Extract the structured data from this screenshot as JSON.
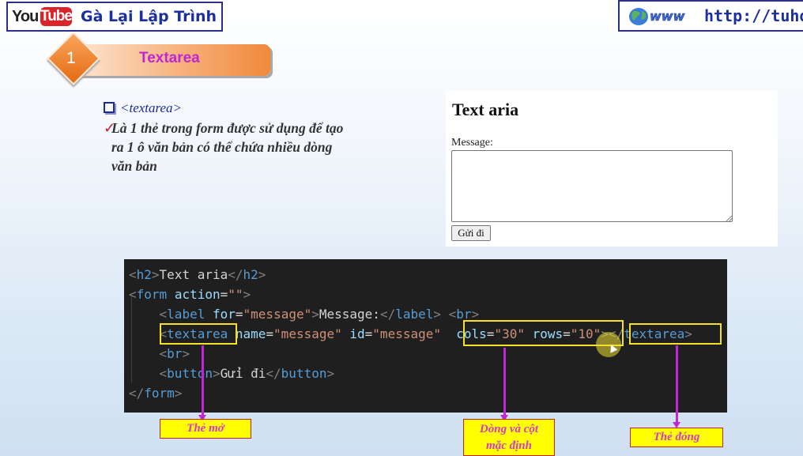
{
  "header": {
    "logo_you": "You",
    "logo_tube": "Tube",
    "channel_title": "Gà Lại Lập Trình",
    "www_logo_text": "www",
    "url": "http://tuhoc"
  },
  "section": {
    "number": "1",
    "title": "Textarea"
  },
  "bullets": {
    "heading": "<textarea>",
    "description_line1": "Là 1 thẻ trong form được sử dụng để tạo",
    "description_line2": "ra 1 ô văn bản có thể chứa  nhiều dòng",
    "description_line3": "văn bản"
  },
  "preview": {
    "heading": "Text aria",
    "label": "Message:",
    "textarea_value": "",
    "button_label": "Gửi đi"
  },
  "code": {
    "lines": [
      [
        [
          "t",
          "<"
        ],
        [
          "n",
          "h2"
        ],
        [
          "t",
          ">"
        ],
        [
          "w",
          "Text aria"
        ],
        [
          "t",
          "</"
        ],
        [
          "n",
          "h2"
        ],
        [
          "t",
          ">"
        ]
      ],
      [
        [
          "t",
          "<"
        ],
        [
          "n",
          "form"
        ],
        [
          "w",
          " "
        ],
        [
          "a",
          "action"
        ],
        [
          "w",
          "="
        ],
        [
          "s",
          "\"\""
        ],
        [
          "t",
          ">"
        ]
      ],
      [
        [
          "w",
          "    "
        ],
        [
          "t",
          "<"
        ],
        [
          "n",
          "label"
        ],
        [
          "w",
          " "
        ],
        [
          "a",
          "for"
        ],
        [
          "w",
          "="
        ],
        [
          "s",
          "\"message\""
        ],
        [
          "t",
          ">"
        ],
        [
          "w",
          "Message:"
        ],
        [
          "t",
          "</"
        ],
        [
          "n",
          "label"
        ],
        [
          "t",
          ">"
        ],
        [
          "w",
          " "
        ],
        [
          "t",
          "<"
        ],
        [
          "n",
          "br"
        ],
        [
          "t",
          ">"
        ]
      ],
      [
        [
          "w",
          "    "
        ],
        [
          "t",
          "<"
        ],
        [
          "n",
          "textarea"
        ],
        [
          "w",
          " "
        ],
        [
          "a",
          "name"
        ],
        [
          "w",
          "="
        ],
        [
          "s",
          "\"message\""
        ],
        [
          "w",
          " "
        ],
        [
          "a",
          "id"
        ],
        [
          "w",
          "="
        ],
        [
          "s",
          "\"message\""
        ],
        [
          "w",
          "  "
        ],
        [
          "a",
          "cols"
        ],
        [
          "w",
          "="
        ],
        [
          "s",
          "\"30\""
        ],
        [
          "w",
          " "
        ],
        [
          "a",
          "rows"
        ],
        [
          "w",
          "="
        ],
        [
          "s",
          "\"10\""
        ],
        [
          "t",
          ">"
        ],
        [
          "t",
          "</"
        ],
        [
          "n",
          "textarea"
        ],
        [
          "t",
          ">"
        ]
      ],
      [
        [
          "w",
          "    "
        ],
        [
          "t",
          "<"
        ],
        [
          "n",
          "br"
        ],
        [
          "t",
          ">"
        ]
      ],
      [
        [
          "w",
          "    "
        ],
        [
          "t",
          "<"
        ],
        [
          "n",
          "button"
        ],
        [
          "t",
          ">"
        ],
        [
          "w",
          "Gửi đi"
        ],
        [
          "t",
          "</"
        ],
        [
          "n",
          "button"
        ],
        [
          "t",
          ">"
        ]
      ],
      [
        [
          "t",
          "</"
        ],
        [
          "n",
          "form"
        ],
        [
          "t",
          ">"
        ]
      ]
    ]
  },
  "callouts": {
    "open_tag": "Thẻ mở",
    "rows_cols_line1": "Dòng và cột",
    "rows_cols_line2": "mặc định",
    "close_tag": "Thẻ đóng"
  },
  "colors": {
    "tag_color": "#808080",
    "element_name": "#569cd6",
    "attribute": "#9cdcfe",
    "string": "#ce9178",
    "highlight_box": "#f5e02a",
    "callout_arrow": "#c026d3",
    "callout_bg": "#ffff00"
  }
}
